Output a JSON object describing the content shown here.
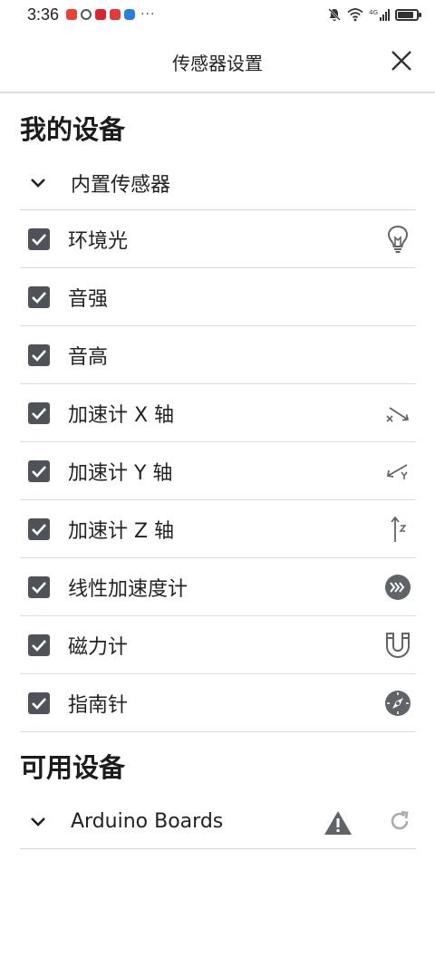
{
  "status_bar": {
    "time": "3:36",
    "more": "···",
    "network": "4G",
    "battery_level": 0.75
  },
  "header": {
    "title": "传感器设置",
    "close_icon": "close-icon"
  },
  "my_devices": {
    "title": "我的设备",
    "group_label": "内置传感器",
    "sensors": [
      {
        "label": "环境光",
        "checked": true,
        "icon": "lightbulb-icon"
      },
      {
        "label": "音强",
        "checked": true,
        "icon": ""
      },
      {
        "label": "音高",
        "checked": true,
        "icon": ""
      },
      {
        "label": "加速计 X 轴",
        "checked": true,
        "icon": "accel-x-icon"
      },
      {
        "label": "加速计 Y 轴",
        "checked": true,
        "icon": "accel-y-icon"
      },
      {
        "label": "加速计 Z 轴",
        "checked": true,
        "icon": "accel-z-icon"
      },
      {
        "label": "线性加速度计",
        "checked": true,
        "icon": "linear-accel-icon"
      },
      {
        "label": "磁力计",
        "checked": true,
        "icon": "magnet-icon"
      },
      {
        "label": "指南针",
        "checked": true,
        "icon": "compass-icon"
      }
    ]
  },
  "available_devices": {
    "title": "可用设备",
    "group_label": "Arduino Boards",
    "warning_icon": "warning-icon",
    "refresh_icon": "refresh-icon"
  },
  "colors": {
    "checkbox": "#4d5358",
    "icon_gray": "#5f6469",
    "divider": "#dcdcdc"
  }
}
